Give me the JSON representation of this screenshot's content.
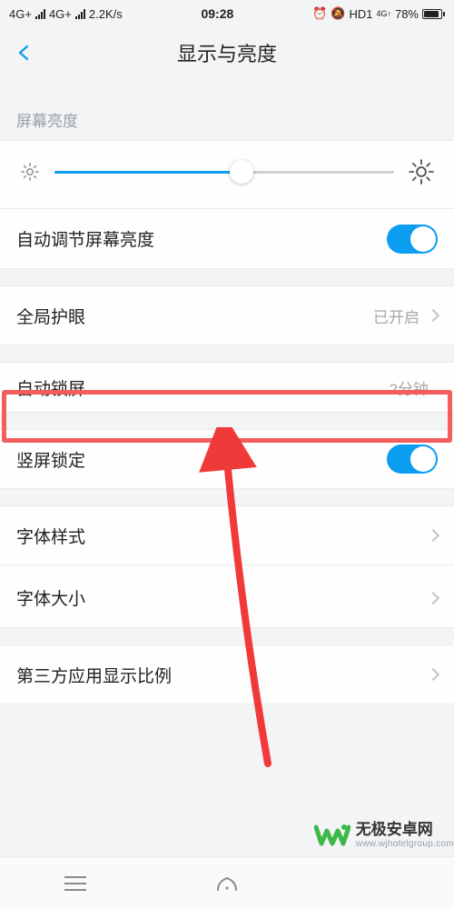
{
  "status": {
    "net1": "4G+",
    "net2": "4G+",
    "speed": "2.2K/s",
    "time": "09:28",
    "hd": "HD1",
    "net_mini": "4G↑",
    "battery_pct": "78%"
  },
  "header": {
    "title": "显示与亮度"
  },
  "brightness_section": {
    "label": "屏幕亮度",
    "slider_value": 55
  },
  "rows": {
    "auto_brightness": "自动调节屏幕亮度",
    "eye_protect": {
      "label": "全局护眼",
      "value": "已开启"
    },
    "auto_lock": {
      "label": "自动锁屏",
      "value": "2分钟"
    },
    "portrait_lock": "竖屏锁定",
    "font_style": "字体样式",
    "font_size": "字体大小",
    "third_party_ratio": "第三方应用显示比例"
  },
  "watermark": {
    "title": "无极安卓网",
    "sub": "www.wjhotelgroup.com"
  }
}
